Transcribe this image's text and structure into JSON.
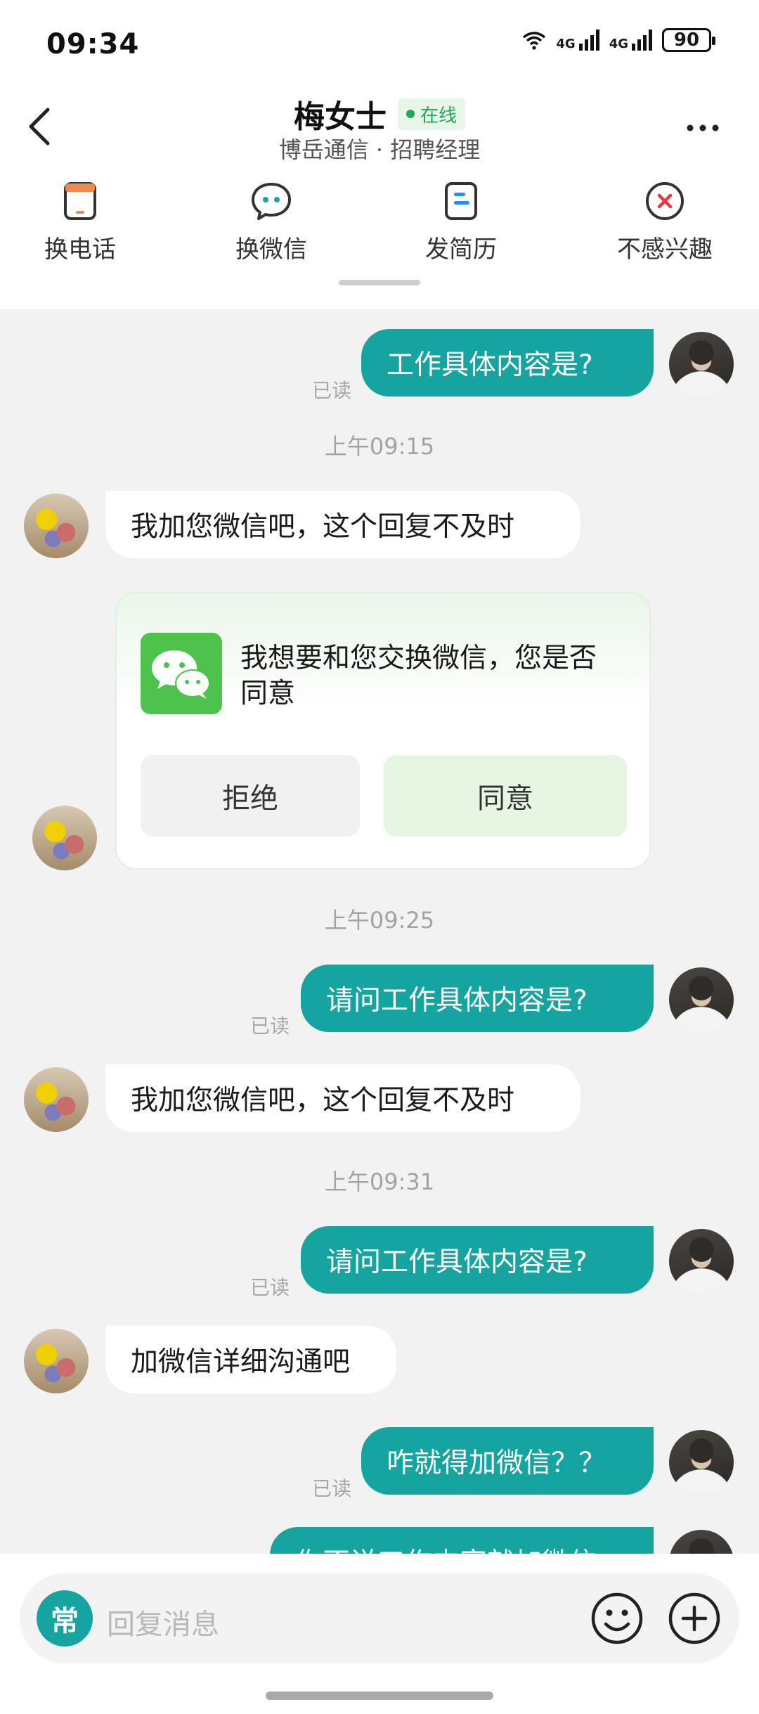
{
  "status_bar": {
    "time": "09:34",
    "network_1": "4G",
    "network_2": "4G",
    "battery": "90"
  },
  "header": {
    "name": "梅女士",
    "online": "在线",
    "subtitle": "博岳通信 · 招聘经理"
  },
  "actions": [
    {
      "label": "换电话",
      "icon": "phone-icon"
    },
    {
      "label": "换微信",
      "icon": "wechat-chat-icon"
    },
    {
      "label": "发简历",
      "icon": "resume-icon"
    },
    {
      "label": "不感兴趣",
      "icon": "close-circle-icon"
    }
  ],
  "messages": {
    "m1": "工作具体内容是?",
    "read": "已读",
    "t1": "上午09:15",
    "m2": "我加您微信吧，这个回复不及时",
    "card_text": "我想要和您交换微信，您是否同意",
    "reject": "拒绝",
    "agree": "同意",
    "t2": "上午09:25",
    "m3": "请问工作具体内容是?",
    "m4": "我加您微信吧，这个回复不及时",
    "t3": "上午09:31",
    "m5": "请问工作具体内容是?",
    "m6": "加微信详细沟通吧",
    "m7": "咋就得加微信？？",
    "m8_partial": "你不说工作内容就加微信"
  },
  "input": {
    "quick_label": "常",
    "placeholder": "回复消息"
  },
  "colors": {
    "accent": "#16a4a0",
    "wechat_green": "#4dc24c",
    "online_green": "#1fa85a",
    "background": "#f2f2f2"
  }
}
